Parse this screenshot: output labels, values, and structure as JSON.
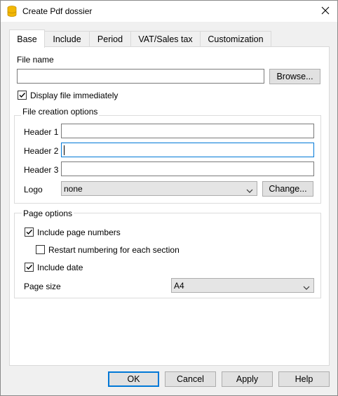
{
  "window": {
    "title": "Create Pdf dossier"
  },
  "tabs": [
    {
      "label": "Base"
    },
    {
      "label": "Include"
    },
    {
      "label": "Period"
    },
    {
      "label": "VAT/Sales tax"
    },
    {
      "label": "Customization"
    }
  ],
  "file": {
    "label": "File name",
    "value": "",
    "browse_label": "Browse...",
    "display_label": "Display file immediately",
    "display_checked": true
  },
  "creation": {
    "title": "File creation options",
    "header1_label": "Header 1",
    "header1_value": "",
    "header2_label": "Header 2",
    "header2_value": "",
    "header3_label": "Header 3",
    "header3_value": "",
    "logo_label": "Logo",
    "logo_value": "none",
    "change_label": "Change..."
  },
  "page_options": {
    "title": "Page options",
    "page_numbers_label": "Include page numbers",
    "page_numbers_checked": true,
    "restart_label": "Restart numbering for each section",
    "restart_checked": false,
    "date_label": "Include date",
    "date_checked": true,
    "page_size_label": "Page size",
    "page_size_value": "A4"
  },
  "footer": {
    "ok": "OK",
    "cancel": "Cancel",
    "apply": "Apply",
    "help": "Help"
  },
  "colors": {
    "accent": "#0078d7",
    "app_icon": "#f2b705"
  }
}
